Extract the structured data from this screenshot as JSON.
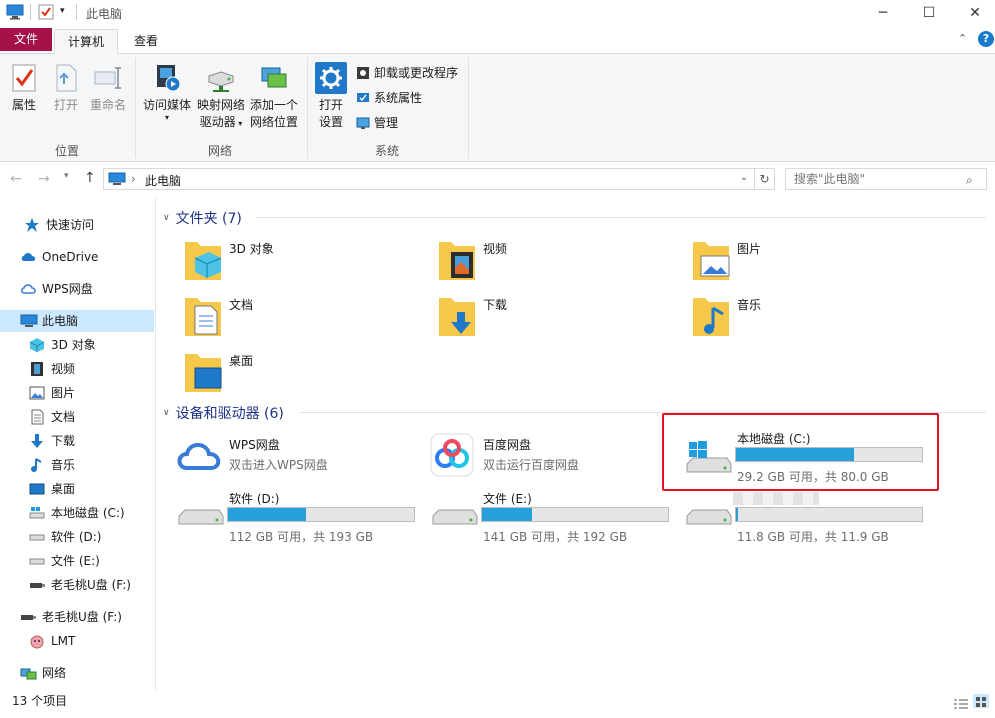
{
  "window": {
    "title": "此电脑",
    "minimize_glyph": "─",
    "maximize_glyph": "☐",
    "close_glyph": "✕"
  },
  "tabs": {
    "file": "文件",
    "computer": "计算机",
    "view": "查看"
  },
  "ribbon": {
    "location": {
      "properties": "属性",
      "open": "打开",
      "rename": "重命名",
      "label": "位置"
    },
    "network": {
      "media_1": "访问媒体",
      "map_1": "映射网络",
      "map_2": "驱动器",
      "add_1": "添加一个",
      "add_2": "网络位置",
      "label": "网络"
    },
    "system": {
      "open_1": "打开",
      "open_2": "设置",
      "uninstall": "卸载或更改程序",
      "sysprops": "系统属性",
      "manage": "管理",
      "label": "系统"
    }
  },
  "address": {
    "path": "此电脑",
    "search_placeholder": "搜索\"此电脑\""
  },
  "sidebar": {
    "quick_access": "快速访问",
    "onedrive": "OneDrive",
    "wps": "WPS网盘",
    "this_pc": "此电脑",
    "obj3d": "3D 对象",
    "video": "视频",
    "pictures": "图片",
    "docs": "文档",
    "downloads": "下载",
    "music": "音乐",
    "desktop": "桌面",
    "drive_c": "本地磁盘 (C:)",
    "drive_d": "软件 (D:)",
    "drive_e": "文件 (E:)",
    "drive_f": "老毛桃U盘 (F:)",
    "usb": "老毛桃U盘 (F:)",
    "lmt": "LMT",
    "network": "网络"
  },
  "folders_section": {
    "title": "文件夹 (7)",
    "items": [
      "3D 对象",
      "视频",
      "图片",
      "文档",
      "下载",
      "音乐",
      "桌面"
    ]
  },
  "devices_section": {
    "title": "设备和驱动器 (6)",
    "wps": {
      "name": "WPS网盘",
      "desc": "双击进入WPS网盘"
    },
    "baidu": {
      "name": "百度网盘",
      "desc": "双击运行百度网盘"
    },
    "drives": [
      {
        "name": "本地磁盘 (C:)",
        "size": "29.2 GB 可用，共 80.0 GB",
        "used_fraction": 0.635
      },
      {
        "name": "软件 (D:)",
        "size": "112 GB 可用，共 193 GB",
        "used_fraction": 0.42
      },
      {
        "name": "文件 (E:)",
        "size": "141 GB 可用，共 192 GB",
        "used_fraction": 0.27
      },
      {
        "name": "",
        "size": "11.8 GB 可用，共 11.9 GB",
        "used_fraction": 0.01
      }
    ]
  },
  "status": {
    "count": "13 个项目"
  },
  "colors": {
    "accent": "#26a0da",
    "file_tab": "#a5124a",
    "highlight_box": "#e81123",
    "section_title": "#1e3287"
  }
}
